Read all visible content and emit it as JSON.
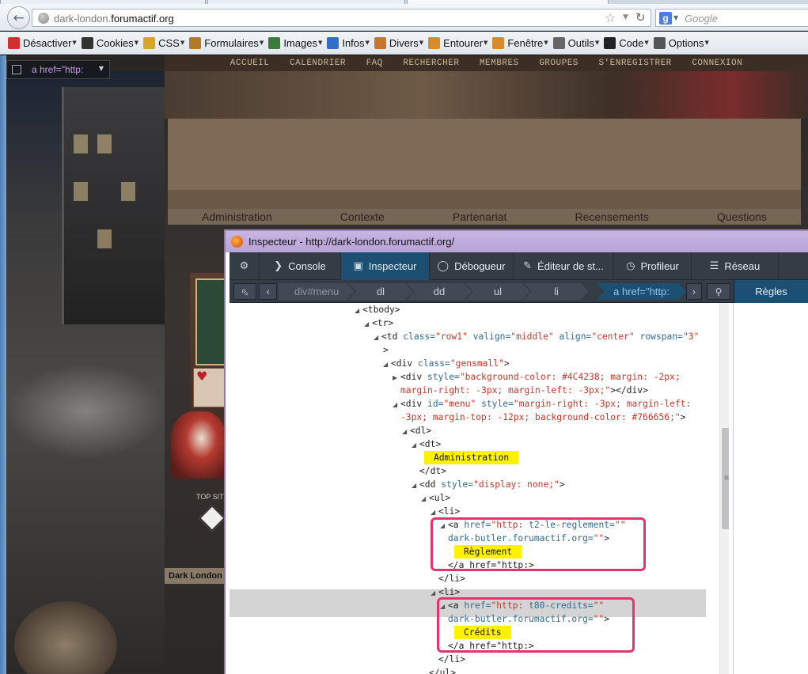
{
  "browser": {
    "url_host": "dark-london.",
    "url_domain": "forumactif.org",
    "search_placeholder": "Google",
    "search_engine_letter": "g"
  },
  "toolbar": {
    "items": [
      {
        "label": "Désactiver",
        "color": "#d32f2f"
      },
      {
        "label": "Cookies",
        "color": "#333333"
      },
      {
        "label": "CSS",
        "color": "#d9a526"
      },
      {
        "label": "Formulaires",
        "color": "#b07a2a"
      },
      {
        "label": "Images",
        "color": "#3c7a3c"
      },
      {
        "label": "Infos",
        "color": "#2f6fc7"
      },
      {
        "label": "Divers",
        "color": "#c8762b"
      },
      {
        "label": "Entourer",
        "color": "#d88b2a"
      },
      {
        "label": "Fenêtre",
        "color": "#d88b2a"
      },
      {
        "label": "Outils",
        "color": "#666666"
      },
      {
        "label": "Code",
        "color": "#222222"
      },
      {
        "label": "Options",
        "color": "#555555"
      }
    ]
  },
  "site": {
    "top_nav": [
      "ACCUEIL",
      "CALENDRIER",
      "FAQ",
      "RECHERCHER",
      "MEMBRES",
      "GROUPES",
      "S'ENREGISTRER",
      "CONNEXION"
    ],
    "menu": [
      "Administration",
      "Contexte",
      "Partenariat",
      "Recensements",
      "Questions"
    ],
    "top_site_label": "TOP SITES",
    "footer_name": "Dark London",
    "picker_label": "a href=\"http:"
  },
  "inspector": {
    "title": "Inspecteur - http://dark-london.forumactif.org/",
    "tabs": [
      "Console",
      "Inspecteur",
      "Débogueur",
      "Éditeur de st...",
      "Profileur",
      "Réseau"
    ],
    "breadcrumbs": {
      "first_tag": "div",
      "first_id": "#menu",
      "items": [
        "dl",
        "dd",
        "ul",
        "li"
      ],
      "active": "a href=\"http:"
    },
    "rules_tab": "Règles",
    "markup": {
      "tbody": "<tbody>",
      "tr": "<tr>",
      "td_open": "<td",
      "td_class_attr": "class=",
      "td_class_val": "\"row1\"",
      "td_valign_attr": "valign=",
      "td_valign_val": "\"middle\"",
      "td_align_attr": "align=",
      "td_align_val": "\"center\"",
      "td_rowspan_attr": "rowspan=",
      "td_rowspan_val": "\"3\"",
      "td_close": ">",
      "div_gensmall_open": "<div",
      "div_gensmall_attr": "class=",
      "div_gensmall_val": "\"gensmall\"",
      "div_gensmall_close": ">",
      "div_bg_open": "<div",
      "div_bg_attr": "style=",
      "div_bg_val1": "\"background-color: #4C4238; margin: -2px;",
      "div_bg_val2": "margin-right: -3px; margin-left: -3px;\"",
      "div_bg_close": "></div>",
      "div_menu_open": "<div",
      "div_menu_id_attr": "id=",
      "div_menu_id_val": "\"menu\"",
      "div_menu_style_attr": "style=",
      "div_menu_style_val1": "\"margin-right: -3px; margin-left:",
      "div_menu_style_val2": "-3px; margin-top: -12px; background-color: #766656;\"",
      "div_menu_close": ">",
      "dl": "<dl>",
      "dt": "<dt>",
      "dt_text": "Administration",
      "dt_close": "</dt>",
      "dd_open": "<dd",
      "dd_style_attr": "style=",
      "dd_style_val": "\"display: none;\"",
      "dd_close": ">",
      "ul": "<ul>",
      "li": "<li>",
      "a1_open": "<a",
      "a1_attr": "href=",
      "a1_val": "\"http:",
      "a1_attr2": "t2-le-reglement=",
      "a1_val2": "\"\"",
      "a1_attr3": "dark-butler.forumactif.org=",
      "a1_val3": "\"\"",
      "a1_close": ">",
      "a1_text": "Règlement",
      "a1_end": "</a href=\"http:>",
      "li_close": "</li>",
      "a2_open": "<a",
      "a2_attr": "href=",
      "a2_val": "\"http:",
      "a2_attr2": "t80-credits=",
      "a2_val2": "\"\"",
      "a2_attr3": "dark-butler.forumactif.org=",
      "a2_val3": "\"\"",
      "a2_close": ">",
      "a2_text": "Crédits",
      "a2_end": "</a href=\"http:>",
      "li_close_partial": "</li>",
      "ul_close": "</ul>"
    }
  },
  "colors": {
    "highlight": "#fff200",
    "annotation_box": "#e5336c",
    "active_tab": "#1d4f73"
  }
}
